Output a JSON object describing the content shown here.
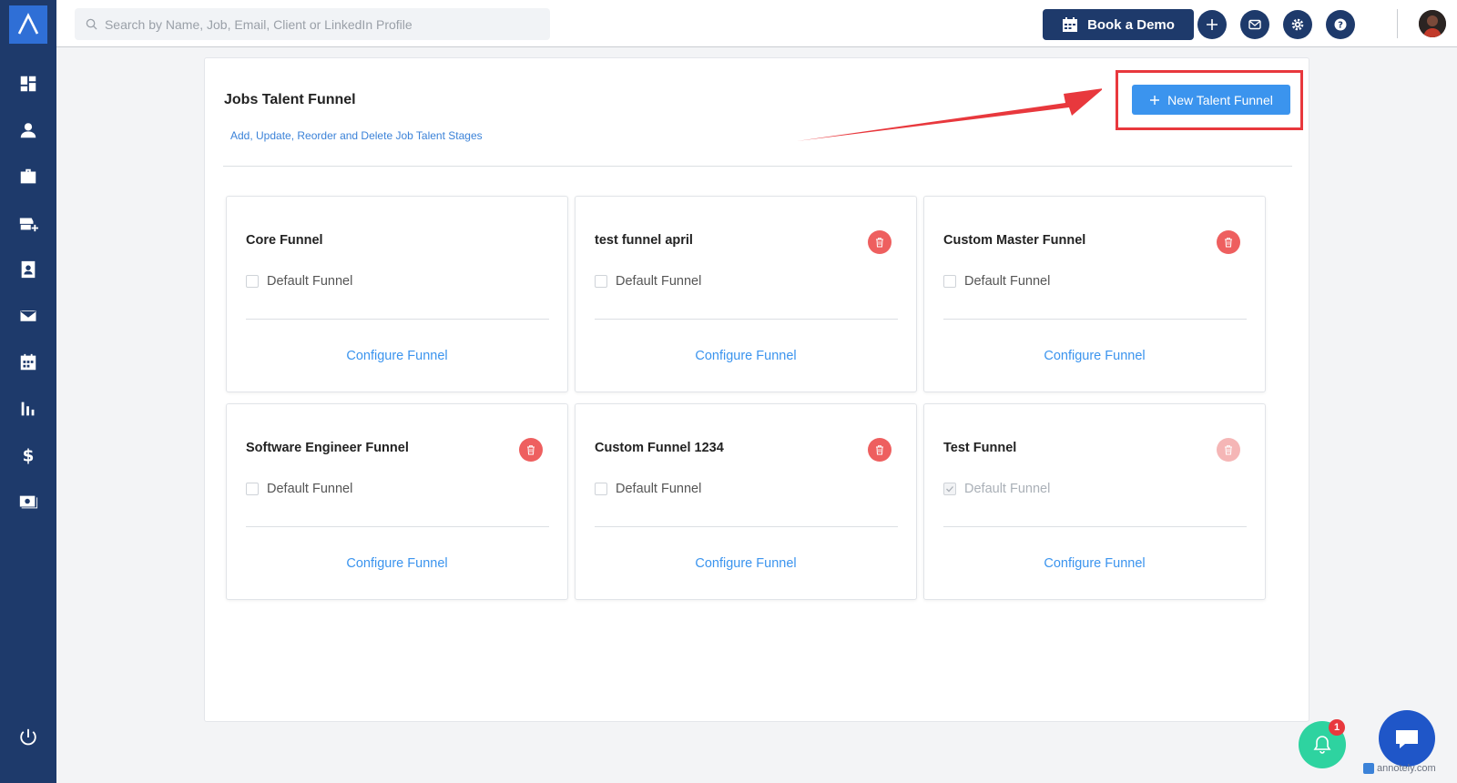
{
  "search": {
    "placeholder": "Search by Name, Job, Email, Client or LinkedIn Profile"
  },
  "header": {
    "book_demo_label": "Book a Demo"
  },
  "page": {
    "title": "Jobs Talent Funnel",
    "subtitle": "Add, Update, Reorder and Delete Job Talent Stages",
    "new_button_label": "New Talent Funnel"
  },
  "funnels": [
    {
      "name": "Core Funnel",
      "default_label": "Default Funnel",
      "configure_label": "Configure Funnel",
      "default_checked": false,
      "deletable": false
    },
    {
      "name": "test funnel april",
      "default_label": "Default Funnel",
      "configure_label": "Configure Funnel",
      "default_checked": false,
      "deletable": true
    },
    {
      "name": "Custom Master Funnel",
      "default_label": "Default Funnel",
      "configure_label": "Configure Funnel",
      "default_checked": false,
      "deletable": true
    },
    {
      "name": "Software Engineer Funnel",
      "default_label": "Default Funnel",
      "configure_label": "Configure Funnel",
      "default_checked": false,
      "deletable": true
    },
    {
      "name": "Custom Funnel 1234",
      "default_label": "Default Funnel",
      "configure_label": "Configure Funnel",
      "default_checked": false,
      "deletable": true
    },
    {
      "name": "Test Funnel",
      "default_label": "Default Funnel",
      "configure_label": "Configure Funnel",
      "default_checked": true,
      "deletable": false
    }
  ],
  "notifications": {
    "count": "1"
  },
  "watermark": {
    "text": "annotely.com"
  },
  "colors": {
    "sidebar": "#1e3a6b",
    "accent": "#3b94ee",
    "danger": "#ee5f5f",
    "highlight": "#e8383d",
    "bell": "#2ed3a0",
    "chat": "#1f56c8"
  }
}
